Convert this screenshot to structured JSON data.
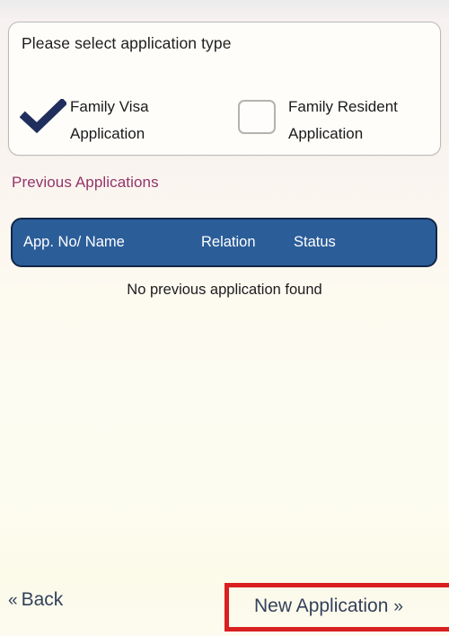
{
  "screen": {
    "background_top": "#f7f1f1",
    "background_bottom": "#fdfbef"
  },
  "card": {
    "title": "Please select application type",
    "options": [
      {
        "id": "family-visa",
        "line1": "Family Visa",
        "line2": "Application",
        "selected": true,
        "icon": "check-mark-icon",
        "check_color": "#1f2e5c"
      },
      {
        "id": "family-resident",
        "line1": "Family Resident",
        "line2": "Application",
        "selected": false,
        "icon": "empty-checkbox-icon",
        "box_border_color": "#b5b3ad"
      }
    ]
  },
  "previous_applications": {
    "heading": "Previous Applications",
    "heading_color": "#93356b",
    "table": {
      "header_bg": "#2b5d99",
      "header_border": "#122747",
      "columns": [
        "App. No/ Name",
        "Relation",
        "Status"
      ],
      "rows": [],
      "empty_message": "No previous application found"
    }
  },
  "footer": {
    "back_label": "Back",
    "back_chevron": "«",
    "new_application_label": "New Application",
    "new_application_chevron": "»",
    "text_color": "#33415c",
    "highlight_color": "#d91f1f"
  }
}
